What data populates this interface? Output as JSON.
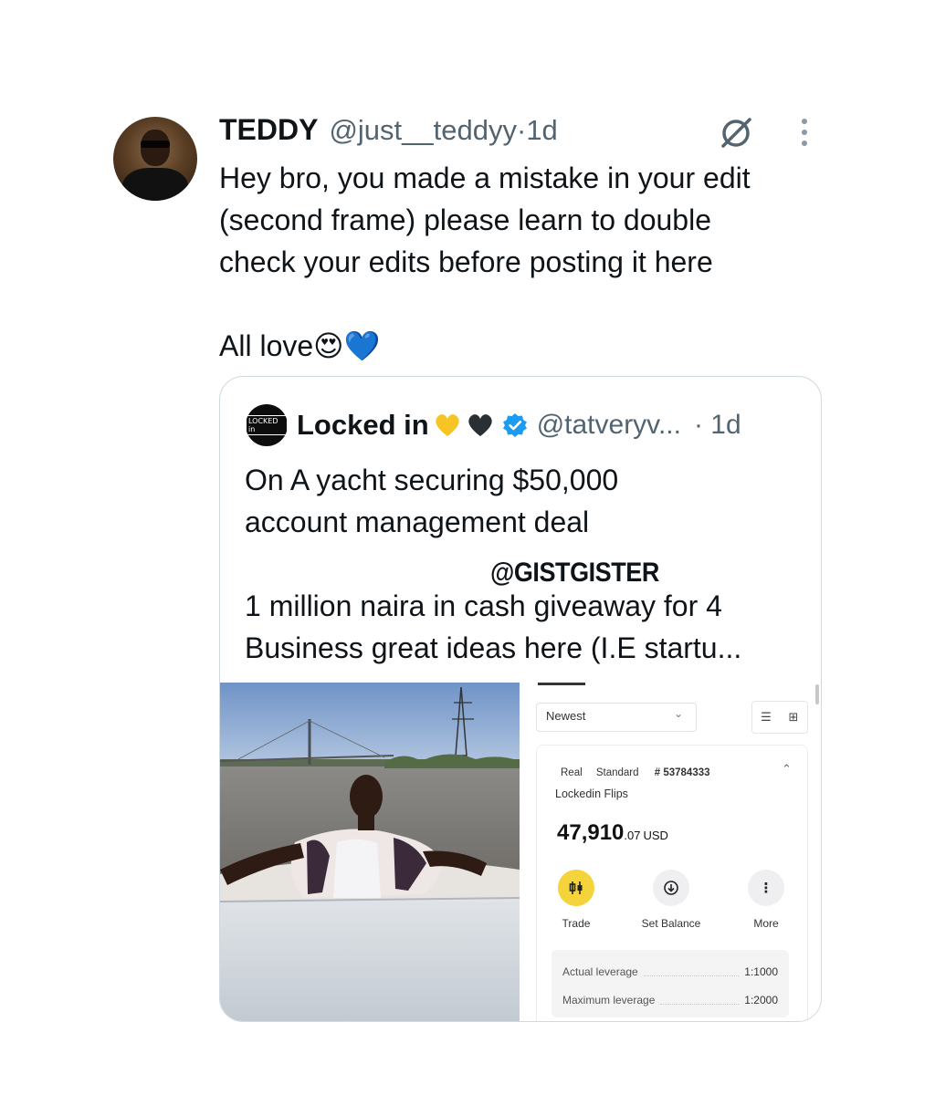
{
  "tweet": {
    "author_name": "TEDDY",
    "author_handle": "@just__teddyy",
    "time_sep": " · ",
    "time": "1d",
    "text": "Hey bro, you made a mistake in your edit\n(second frame) please learn to double\ncheck your edits before posting it here\n\nAll love😍💙",
    "icons": {
      "grok": "grok-slash-icon",
      "more": "vertical-dots-icon"
    }
  },
  "quote": {
    "avatar_text": "LOCKED in",
    "name": "Locked in",
    "name_hearts": [
      "💛",
      "🖤"
    ],
    "handle": "@tatveryv...",
    "time": "· 1d",
    "text": "On A yacht securing $50,000\naccount management deal\n\n1 million naira in cash giveaway for 4\nBusiness great ideas here (I.E startu...",
    "watermark": "@GISTGISTER",
    "verified_color": "#1d9bf0"
  },
  "screenshot": {
    "sort_select": "Newest",
    "account": {
      "type": "Real",
      "tier": "Standard",
      "number": "# 53784333",
      "name": "Lockedin Flips",
      "balance_main": "47,910",
      "balance_cents": ".07",
      "currency": "USD"
    },
    "actions": [
      {
        "label": "Trade",
        "icon": "candlestick-icon",
        "color": "#f5d33a"
      },
      {
        "label": "Set Balance",
        "icon": "download-circle-icon",
        "color": "#efeff1"
      },
      {
        "label": "More",
        "icon": "vertical-dots-icon",
        "color": "#efeff1"
      }
    ],
    "leverage": [
      {
        "label": "Actual leverage",
        "value": "1:1000"
      },
      {
        "label": "Maximum leverage",
        "value": "1:2000"
      }
    ]
  }
}
